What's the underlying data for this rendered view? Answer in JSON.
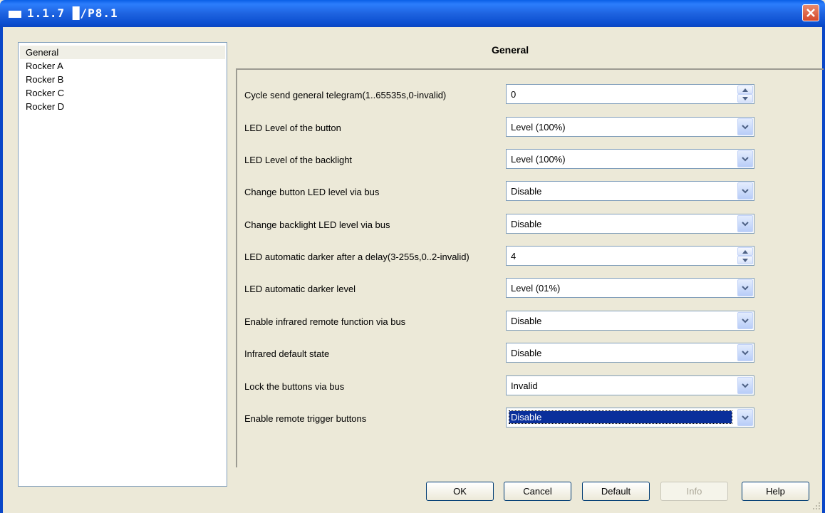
{
  "window": {
    "title": "1.1.7 █/P8.1"
  },
  "tree": {
    "items": [
      "General",
      "Rocker A",
      "Rocker B",
      "Rocker C",
      "Rocker D"
    ],
    "selected": "General"
  },
  "section": {
    "title": "General"
  },
  "params": [
    {
      "label": "Cycle send general telegram(1..65535s,0-invalid)",
      "value": "0",
      "control": "spinner"
    },
    {
      "label": "LED Level of the button",
      "value": "Level (100%)",
      "control": "dropdown"
    },
    {
      "label": "LED Level of the backlight",
      "value": "Level (100%)",
      "control": "dropdown"
    },
    {
      "label": "Change button LED level via bus",
      "value": "Disable",
      "control": "dropdown"
    },
    {
      "label": "Change backlight LED level via bus",
      "value": "Disable",
      "control": "dropdown"
    },
    {
      "label": "LED automatic darker after a delay(3-255s,0..2-invalid)",
      "value": "4",
      "control": "spinner"
    },
    {
      "label": "LED automatic darker level",
      "value": "Level (01%)",
      "control": "dropdown"
    },
    {
      "label": "Enable infrared remote function via bus",
      "value": "Disable",
      "control": "dropdown"
    },
    {
      "label": "Infrared default state",
      "value": "Disable",
      "control": "dropdown"
    },
    {
      "label": "Lock the buttons via bus",
      "value": "Invalid",
      "control": "dropdown"
    },
    {
      "label": "Enable remote trigger buttons",
      "value": "Disable",
      "control": "dropdown",
      "focused": true
    }
  ],
  "buttons": {
    "ok": "OK",
    "cancel": "Cancel",
    "default": "Default",
    "info": "Info",
    "help": "Help"
  }
}
